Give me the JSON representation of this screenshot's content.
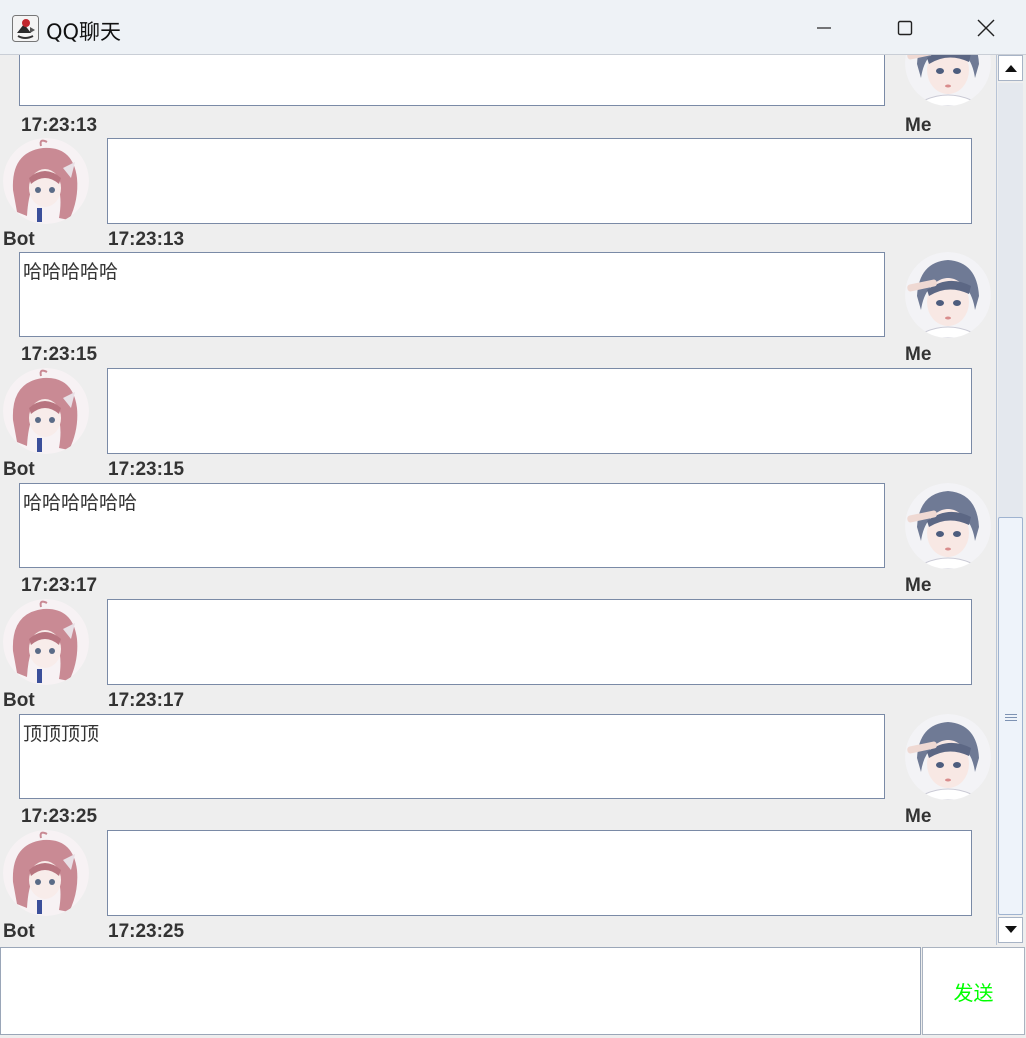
{
  "window": {
    "title": "QQ聊天"
  },
  "messages": [
    {
      "sender": "me",
      "text": "",
      "time": "17:23:13",
      "name": "Me"
    },
    {
      "sender": "bot",
      "text": "",
      "time": "17:23:13",
      "name": "Bot"
    },
    {
      "sender": "me",
      "text": "哈哈哈哈哈",
      "time": "17:23:15",
      "name": "Me"
    },
    {
      "sender": "bot",
      "text": "",
      "time": "17:23:15",
      "name": "Bot"
    },
    {
      "sender": "me",
      "text": "哈哈哈哈哈哈",
      "time": "17:23:17",
      "name": "Me"
    },
    {
      "sender": "bot",
      "text": "",
      "time": "17:23:17",
      "name": "Bot"
    },
    {
      "sender": "me",
      "text": "顶顶顶顶",
      "time": "17:23:25",
      "name": "Me"
    },
    {
      "sender": "bot",
      "text": "",
      "time": "17:23:25",
      "name": "Bot"
    }
  ],
  "input": {
    "value": ""
  },
  "send": {
    "label": "发送"
  },
  "colors": {
    "send_text": "#00ff00",
    "titlebar_bg": "#eef2f6",
    "chat_bg": "#eeeeee"
  },
  "icons": [
    "java-coffee-app-icon",
    "minimize-icon",
    "maximize-icon",
    "close-icon",
    "scroll-up-arrow-icon",
    "scroll-down-arrow-icon"
  ]
}
